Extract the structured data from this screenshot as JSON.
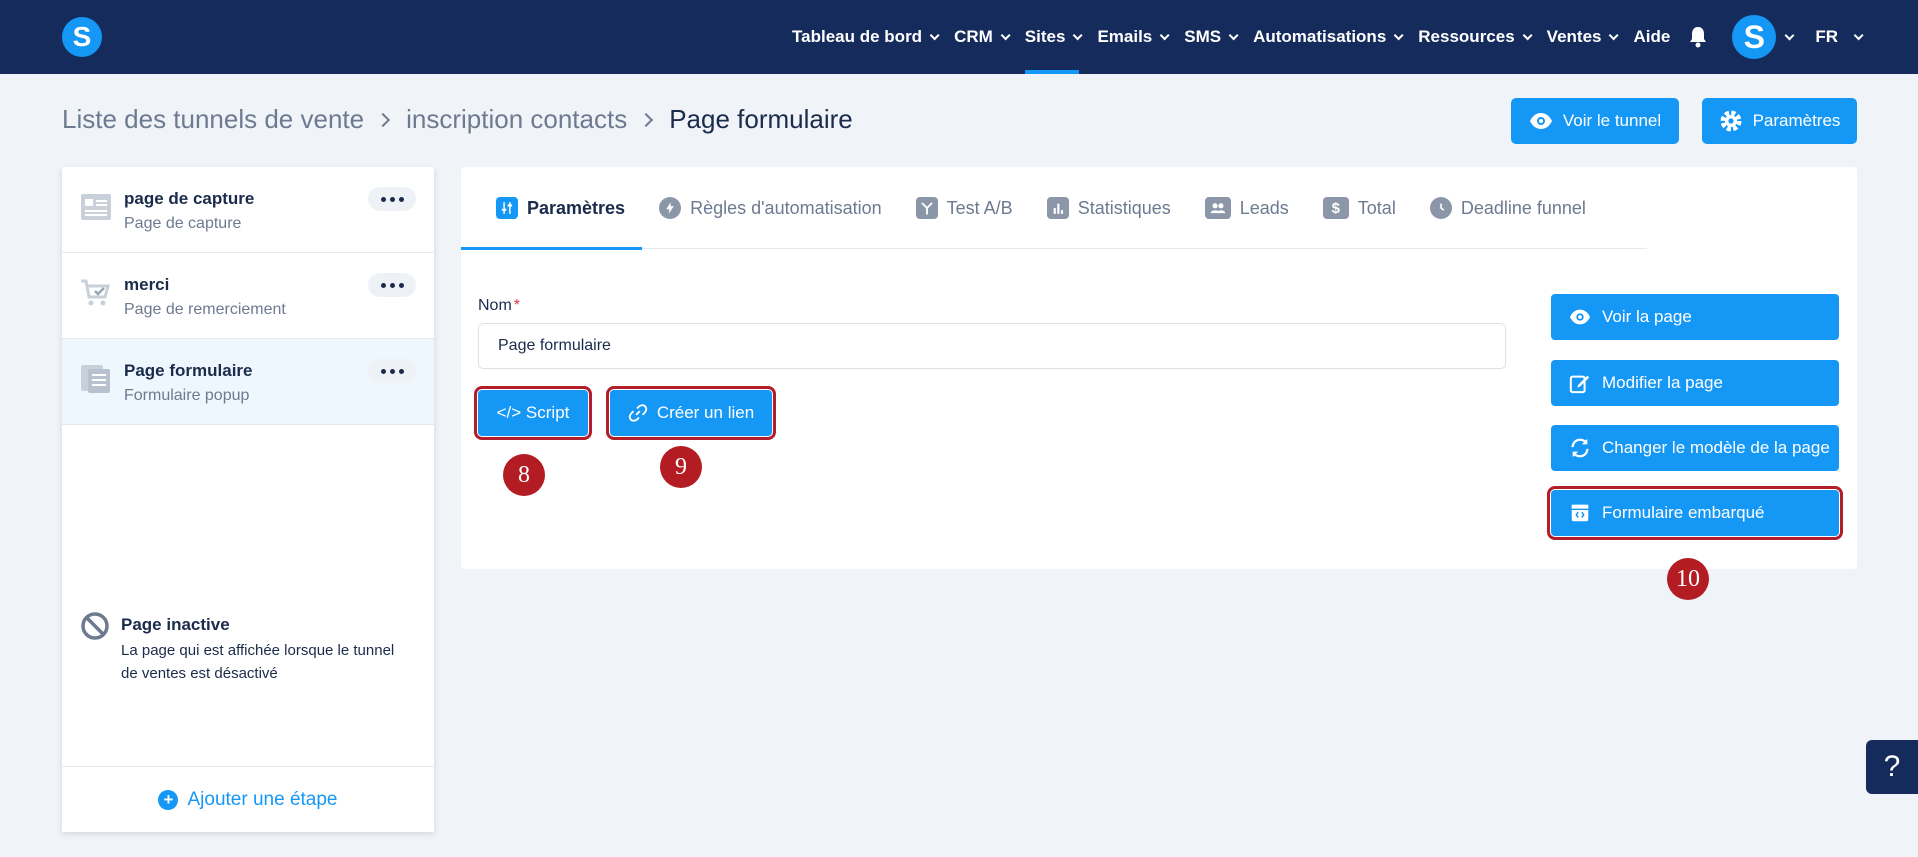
{
  "nav": {
    "logo": "S",
    "items": [
      {
        "label": "Tableau de bord",
        "chevron": true
      },
      {
        "label": "CRM",
        "chevron": true
      },
      {
        "label": "Sites",
        "chevron": true,
        "active": true
      },
      {
        "label": "Emails",
        "chevron": true
      },
      {
        "label": "SMS",
        "chevron": true
      },
      {
        "label": "Automatisations",
        "chevron": true
      },
      {
        "label": "Ressources",
        "chevron": true
      },
      {
        "label": "Ventes",
        "chevron": true
      },
      {
        "label": "Aide",
        "chevron": false
      }
    ],
    "avatar": "S",
    "language": "FR"
  },
  "breadcrumb": [
    "Liste des tunnels de vente",
    "inscription contacts",
    "Page formulaire"
  ],
  "header_buttons": {
    "view_funnel": "Voir le tunnel",
    "settings": "Paramètres"
  },
  "sidebar": {
    "steps": [
      {
        "title": "page de capture",
        "subtitle": "Page de capture",
        "icon": "capture-page-icon"
      },
      {
        "title": "merci",
        "subtitle": "Page de remerciement",
        "icon": "cart-check-icon"
      },
      {
        "title": "Page formulaire",
        "subtitle": "Formulaire popup",
        "icon": "form-page-icon",
        "active": true
      }
    ],
    "inactive": {
      "title": "Page inactive",
      "description": "La page qui est affichée lorsque le tunnel de ventes est désactivé"
    },
    "add_step": "Ajouter une étape"
  },
  "tabs": [
    {
      "label": "Paramètres",
      "icon": "sliders-icon",
      "active": true
    },
    {
      "label": "Règles d'automatisation",
      "icon": "bolt-icon"
    },
    {
      "label": "Test A/B",
      "icon": "split-icon"
    },
    {
      "label": "Statistiques",
      "icon": "bar-chart-icon"
    },
    {
      "label": "Leads",
      "icon": "users-icon"
    },
    {
      "label": "Total",
      "icon": "dollar-icon"
    },
    {
      "label": "Deadline funnel",
      "icon": "clock-icon"
    }
  ],
  "form": {
    "name_label": "Nom",
    "required_mark": "*",
    "name_value": "Page formulaire"
  },
  "actions": {
    "script": "</> Script",
    "create_link": "Créer un lien"
  },
  "side_actions": {
    "view_page": "Voir la page",
    "edit_page": "Modifier la page",
    "change_template": "Changer le modèle de la page",
    "embedded_form": "Formulaire embarqué"
  },
  "annotations": {
    "script": "8",
    "link": "9",
    "embedded": "10"
  },
  "help": "?",
  "colors": {
    "nav_bg": "#152b5c",
    "accent": "#1597f5",
    "badge": "#b41c24"
  }
}
